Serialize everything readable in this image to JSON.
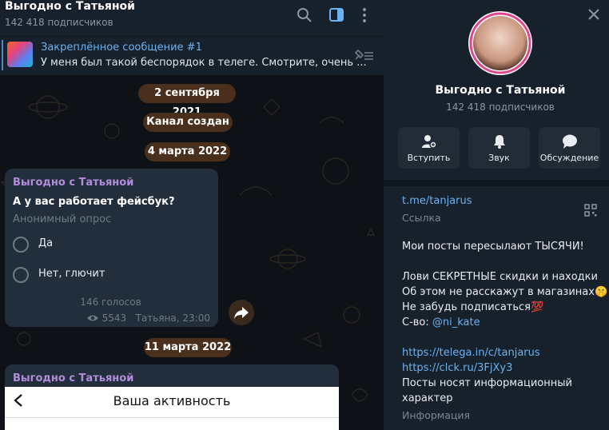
{
  "channel": {
    "title": "Выгодно с Татьяной",
    "subscribers": "142 418 подписчиков"
  },
  "pinned": {
    "title": "Закреплённое сообщение #1",
    "text": "У меня был такой беспорядок в телеге. Смотрите, очень ..."
  },
  "dates": [
    "2 сентября 2021",
    "Канал создан",
    "4 марта 2022",
    "11 марта 2022"
  ],
  "poll": {
    "author": "Выгодно с Татьяной",
    "question": "А у вас работает фейсбук?",
    "type": "Анонимный опрос",
    "options": [
      "Да",
      "Нет, глючит"
    ],
    "votes": "146 голосов",
    "views": "5543",
    "signature": "Татьяна, 23:00"
  },
  "next_post": {
    "author": "Выгодно с Татьяной",
    "screen_title": "Ваша активность"
  },
  "profile": {
    "title": "Выгодно с Татьяной",
    "subscribers": "142 418 подписчиков",
    "actions": [
      "Вступить",
      "Звук",
      "Обсуждение"
    ],
    "link": "t.me/tanjarus",
    "link_label": "Ссылка",
    "description": {
      "line1": "Мои посты пересылают ТЫСЯЧИ!",
      "line2": "Лови СЕКРЕТНЫЕ скидки и находки",
      "line3": "Об этом не расскажут в магазинах🤫",
      "line4": "Не забудь подписаться💯",
      "line5_prefix": "С-во: ",
      "line5_mention": "@ni_kate",
      "link1": "https://telega.in/c/tanjarus",
      "link2": "https://clck.ru/3FjXy3",
      "line8": "Посты носят информационный",
      "line9": "характер"
    },
    "info_label": "Информация"
  },
  "colors": {
    "accent": "#6ab2f2",
    "author": "#b28ddb",
    "date_pill": "#4a2f1c"
  }
}
